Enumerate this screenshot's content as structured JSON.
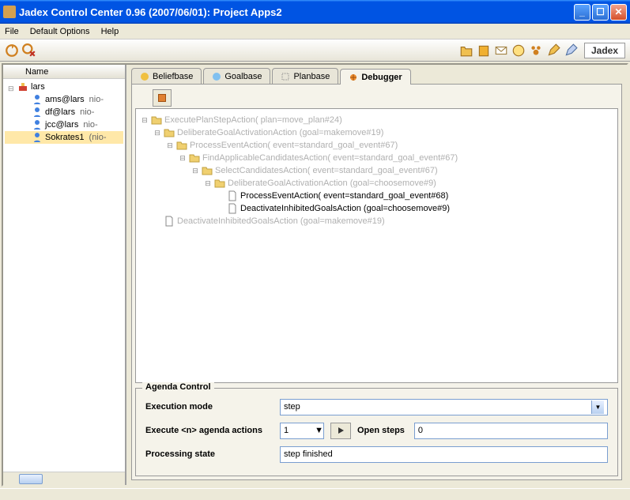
{
  "window": {
    "title": "Jadex Control Center 0.96 (2007/06/01): Project Apps2"
  },
  "menu": {
    "file": "File",
    "default_options": "Default Options",
    "help": "Help"
  },
  "logo": "Jadex",
  "left": {
    "header": "Name",
    "root": "lars",
    "agents": [
      {
        "label": "ams@lars",
        "addr": "nio-"
      },
      {
        "label": "df@lars",
        "addr": "nio-"
      },
      {
        "label": "jcc@lars",
        "addr": "nio-"
      },
      {
        "label": "Sokrates1",
        "addr": "(nio-"
      }
    ]
  },
  "tabs": {
    "beliefbase": "Beliefbase",
    "goalbase": "Goalbase",
    "planbase": "Planbase",
    "debugger": "Debugger"
  },
  "exec_tree": [
    {
      "depth": 0,
      "type": "folder",
      "open": true,
      "text": "ExecutePlanStepAction( plan=move_plan#24)",
      "active": false
    },
    {
      "depth": 1,
      "type": "folder",
      "open": true,
      "text": "DeliberateGoalActivationAction (goal=makemove#19)",
      "active": false
    },
    {
      "depth": 2,
      "type": "folder",
      "open": true,
      "text": "ProcessEventAction( event=standard_goal_event#67)",
      "active": false
    },
    {
      "depth": 3,
      "type": "folder",
      "open": true,
      "text": "FindApplicableCandidatesAction( event=standard_goal_event#67)",
      "active": false
    },
    {
      "depth": 4,
      "type": "folder",
      "open": true,
      "text": "SelectCandidatesAction( event=standard_goal_event#67)",
      "active": false
    },
    {
      "depth": 5,
      "type": "folder",
      "open": true,
      "text": "DeliberateGoalActivationAction (goal=choosemove#9)",
      "active": false
    },
    {
      "depth": 6,
      "type": "file",
      "text": "ProcessEventAction( event=standard_goal_event#68)",
      "active": true
    },
    {
      "depth": 6,
      "type": "file",
      "text": "DeactivateInhibitedGoalsAction (goal=choosemove#9)",
      "active": true
    },
    {
      "depth": 1,
      "type": "file",
      "text": "DeactivateInhibitedGoalsAction (goal=makemove#19)",
      "active": false
    }
  ],
  "agenda": {
    "title": "Agenda Control",
    "exec_mode_label": "Execution mode",
    "exec_mode_value": "step",
    "exec_n_label": "Execute <n> agenda actions",
    "exec_n_value": "1",
    "open_steps_label": "Open steps",
    "open_steps_value": "0",
    "processing_label": "Processing state",
    "processing_value": "step finished"
  }
}
